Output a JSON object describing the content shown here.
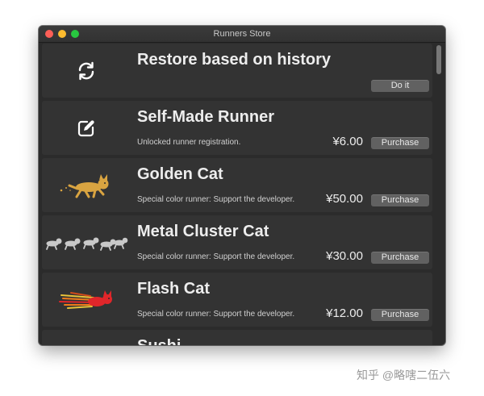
{
  "window": {
    "title": "Runners Store"
  },
  "items": [
    {
      "title": "Restore based on history",
      "description": "",
      "price": "",
      "button": "Do it",
      "icon": "refresh-icon"
    },
    {
      "title": "Self-Made Runner",
      "description": "Unlocked runner registration.",
      "price": "¥6.00",
      "button": "Purchase",
      "icon": "edit-icon"
    },
    {
      "title": "Golden Cat",
      "description": "Special color runner: Support the developer.",
      "price": "¥50.00",
      "button": "Purchase",
      "icon": "golden-cat-icon"
    },
    {
      "title": "Metal Cluster Cat",
      "description": "Special color runner: Support the developer.",
      "price": "¥30.00",
      "button": "Purchase",
      "icon": "metal-cluster-cat-icon"
    },
    {
      "title": "Flash Cat",
      "description": "Special color runner: Support the developer.",
      "price": "¥12.00",
      "button": "Purchase",
      "icon": "flash-cat-icon"
    },
    {
      "title": "Sushi",
      "description": "",
      "price": "",
      "button": "",
      "icon": "sushi-icon"
    }
  ],
  "watermark": "知乎 @略嗐二伍六",
  "colors": {
    "window_bg": "#2b2b2b",
    "row_bg": "#333333",
    "button_bg": "#616161",
    "text": "#ededed",
    "cat_gold": "#d9a441",
    "cat_red": "#e0262a"
  }
}
